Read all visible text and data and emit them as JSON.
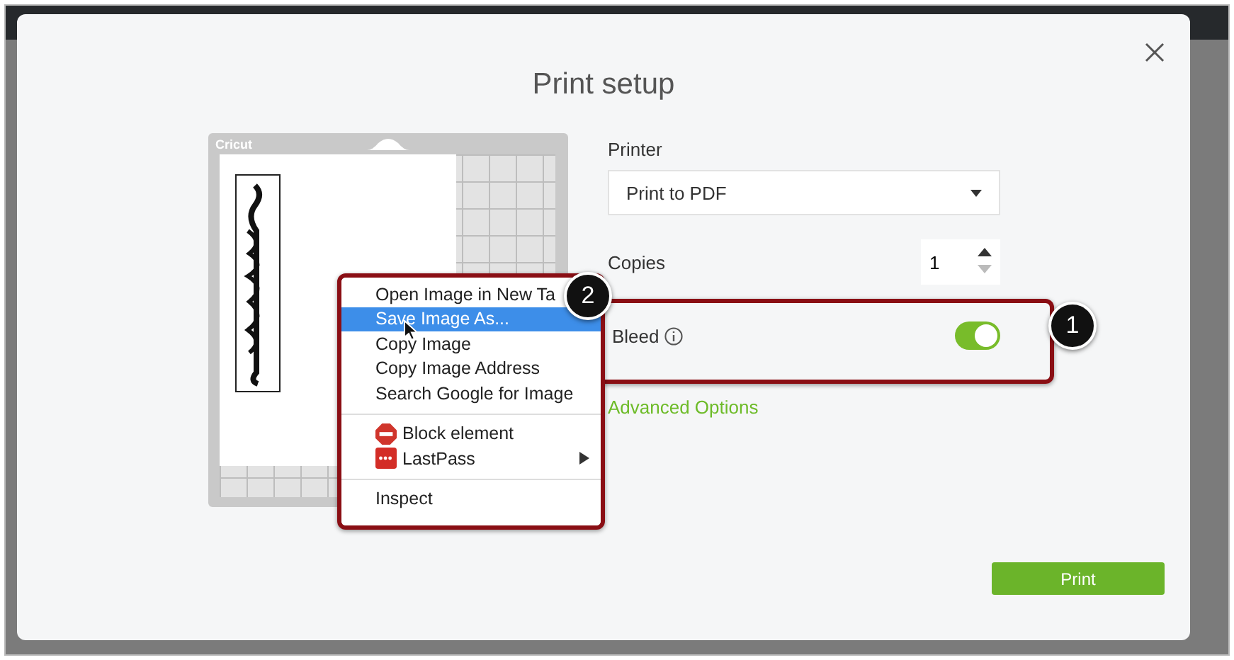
{
  "dialog": {
    "title": "Print setup"
  },
  "mat": {
    "brand": "Cricut"
  },
  "printer": {
    "label": "Printer",
    "value": "Print to PDF"
  },
  "copies": {
    "label": "Copies",
    "value": "1"
  },
  "bleed": {
    "label": "Bleed",
    "on": true
  },
  "advanced_link": "Advanced Options",
  "print_button": "Print",
  "context_menu": {
    "groups": [
      [
        {
          "label": "Open Image in New Ta",
          "kind": "plain",
          "selected": false
        },
        {
          "label": "Save Image As...",
          "kind": "plain",
          "selected": true
        },
        {
          "label": "Copy Image",
          "kind": "plain",
          "selected": false
        },
        {
          "label": "Copy Image Address",
          "kind": "plain",
          "selected": false
        },
        {
          "label": "Search Google for Image",
          "kind": "plain",
          "selected": false
        }
      ],
      [
        {
          "label": "Block element",
          "kind": "blocker",
          "selected": false
        },
        {
          "label": "LastPass",
          "kind": "password-submenu",
          "selected": false
        }
      ],
      [
        {
          "label": "Inspect",
          "kind": "plain",
          "selected": false
        }
      ]
    ]
  },
  "callouts": [
    {
      "number": "1"
    },
    {
      "number": "2"
    }
  ]
}
